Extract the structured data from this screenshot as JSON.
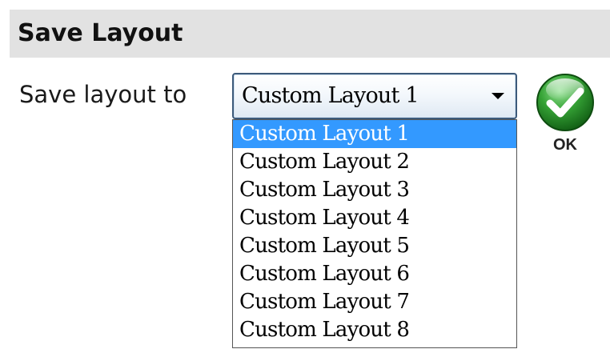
{
  "section": {
    "title": "Save Layout"
  },
  "form": {
    "label": "Save layout to",
    "selected_value": "Custom Layout 1"
  },
  "dropdown": {
    "options": [
      "Custom Layout 1",
      "Custom Layout 2",
      "Custom Layout 3",
      "Custom Layout 4",
      "Custom Layout 5",
      "Custom Layout 6",
      "Custom Layout 7",
      "Custom Layout 8"
    ],
    "highlighted_index": 0
  },
  "ok_button": {
    "label": "OK",
    "icon": "checkmark-icon"
  },
  "colors": {
    "header_bg": "#e2e2e2",
    "highlight": "#3399ff",
    "ok_green": "#2e9a2e"
  }
}
